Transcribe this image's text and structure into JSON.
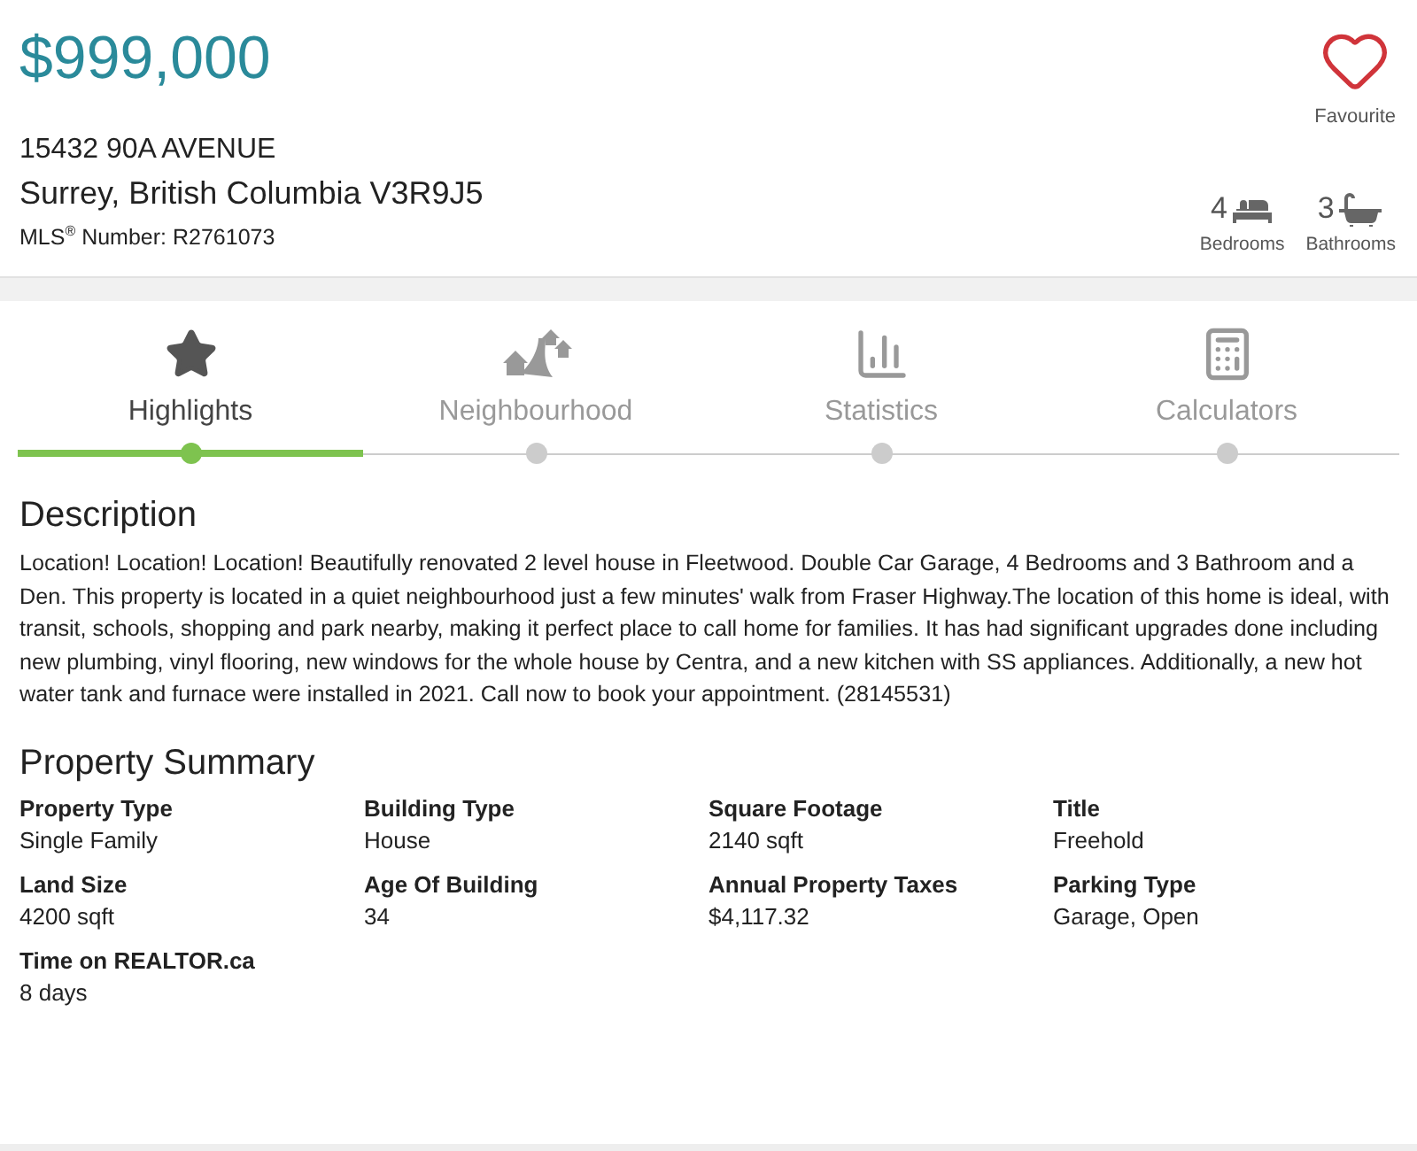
{
  "listing": {
    "price": "$999,000",
    "address_line_1": "15432 90A AVENUE",
    "address_line_2": "Surrey, British Columbia V3R9J5",
    "mls": "MLS$^{®}$ Number: R2761073"
  },
  "favourite": {
    "label": "Favourite"
  },
  "features": [
    {
      "kind": "bed",
      "count": "4",
      "label": "Bedrooms"
    },
    {
      "kind": "bath",
      "count": "3",
      "label": "Bathrooms"
    }
  ],
  "tabs": [
    {
      "kind": "star",
      "label": "Highlights",
      "selected": true
    },
    {
      "kind": "houses",
      "label": "Neighbourhood",
      "selected": false
    },
    {
      "kind": "chart",
      "label": "Statistics",
      "selected": false
    },
    {
      "kind": "calculator",
      "label": "Calculators",
      "selected": false
    }
  ],
  "description": {
    "title": "Description",
    "text": "Location! Location! Location! Beautifully renovated 2 level house in Fleetwood. Double Car Garage, 4 Bedrooms and 3 Bathroom and a Den. This property is located in a quiet neighbourhood just a few minutes' walk from Fraser Highway.The location of this home is ideal, with transit, schools, shopping and park nearby, making it perfect place to call home for families. It has had significant upgrades done including new plumbing, vinyl flooring, new windows for the whole house by Centra, and a new kitchen with SS appliances. Additionally, a new hot water tank and furnace were installed in 2021. Call now to book your appointment. (28145531)"
  },
  "summary": {
    "title": "Property Summary",
    "items": [
      {
        "label": "Property Type",
        "value": "Single Family"
      },
      {
        "label": "Building Type",
        "value": "House"
      },
      {
        "label": "Square Footage",
        "value": "2140 sqft"
      },
      {
        "label": "Title",
        "value": "Freehold"
      },
      {
        "label": "Land Size",
        "value": "4200 sqft"
      },
      {
        "label": "Age Of Building",
        "value": "34"
      },
      {
        "label": "Annual Property Taxes",
        "value": "$4,117.32"
      },
      {
        "label": "Parking Type",
        "value": "Garage, Open"
      },
      {
        "label": "Time on REALTOR.ca",
        "value": "8 days"
      }
    ]
  }
}
